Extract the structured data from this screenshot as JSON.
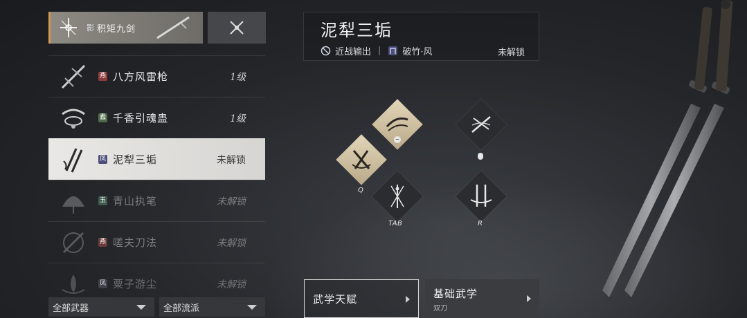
{
  "equipped_weapon": {
    "sect_badge": "影",
    "name": "积矩九剑",
    "icon": "sword-emblem-icon"
  },
  "swap_button": {
    "icon": "crossed-swords-icon"
  },
  "skill_list": [
    {
      "badge": "燕",
      "badge_color": "#8c3b3b",
      "name": "八方风雷枪",
      "state": "1级",
      "icon": "spear-icon",
      "style": "normal"
    },
    {
      "badge": "蠹",
      "badge_color": "#4f6a4a",
      "name": "千香引魂蛊",
      "state": "1级",
      "icon": "gu-bowl-icon",
      "style": "normal"
    },
    {
      "badge": "凤",
      "badge_color": "#4b4f7a",
      "name": "泥犁三垢",
      "state": "未解锁",
      "icon": "dual-blades-icon",
      "style": "selected"
    },
    {
      "badge": "玉",
      "badge_color": "#3f5a4e",
      "name": "青山执笔",
      "state": "未解锁",
      "icon": "fan-icon",
      "style": "dim"
    },
    {
      "badge": "燕",
      "badge_color": "#6b3a3a",
      "name": "嗟夫刀法",
      "state": "未解锁",
      "icon": "blade-circle-icon",
      "style": "dim"
    },
    {
      "badge": "凤",
      "badge_color": "#444650",
      "name": "粟子游尘",
      "state": "未解锁",
      "icon": "lotus-icon",
      "style": "dim"
    }
  ],
  "filters": {
    "weapon": "全部武器",
    "school": "全部流派"
  },
  "header": {
    "title": "泥犁三垢",
    "role_icon": "no-entry-icon",
    "role": "近战输出",
    "school_badge_icon": "feng-badge-icon",
    "school": "破竹·风",
    "state": "未解锁"
  },
  "skills": {
    "tilde_key": "~",
    "q_key": "Q",
    "tab_key": "TAB",
    "mouse_key": "",
    "r_key": "R"
  },
  "tabs": {
    "talent": "武学天赋",
    "basic": "基础武学",
    "basic_sub": "双刀"
  },
  "colors": {
    "accent": "#d9984f",
    "gold_tile": "#d6c8a6",
    "dark_tile": "#2b2c30",
    "selected_row": "#e3e2df"
  }
}
